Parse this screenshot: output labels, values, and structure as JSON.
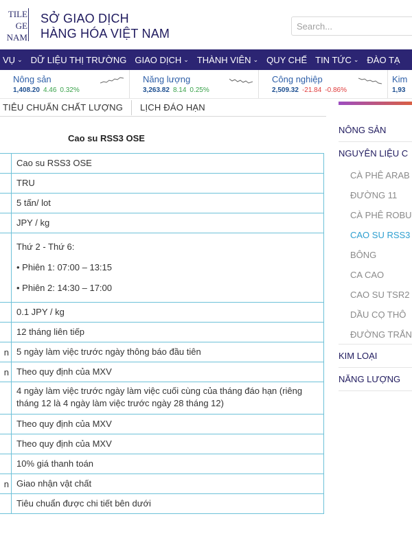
{
  "header": {
    "logo_lines": [
      "TILE",
      "GE",
      "NAM"
    ],
    "org_name_line1": "SỞ GIAO DỊCH",
    "org_name_line2": "HÀNG HÓA VIỆT NAM",
    "search_placeholder": "Search..."
  },
  "nav": {
    "items": [
      "VỤ",
      "DỮ LIỆU THỊ TRƯỜNG",
      "GIAO DỊCH",
      "THÀNH VIÊN",
      "QUY CHẾ",
      "TIN TỨC",
      "ĐÀO TẠ"
    ]
  },
  "ticker": {
    "items": [
      {
        "name": "Nông sản",
        "price": "1,408.20",
        "change": "4.46",
        "pct": "0.32%",
        "dir": "up"
      },
      {
        "name": "Năng lượng",
        "price": "3,263.82",
        "change": "8.14",
        "pct": "0.25%",
        "dir": "up"
      },
      {
        "name": "Công nghiệp",
        "price": "2,509.32",
        "change": "-21.84",
        "pct": "-0.86%",
        "dir": "down"
      },
      {
        "name": "Kim",
        "price": "1,93"
      }
    ]
  },
  "tabs": [
    "TIÊU CHUẨN CHẤT LƯỢNG",
    "LỊCH ĐÁO HẠN"
  ],
  "table": {
    "title": "Cao su RSS3 OSE",
    "rows": [
      {
        "label": "",
        "lines": [
          "Cao su RSS3 OSE"
        ]
      },
      {
        "label": "",
        "lines": [
          "TRU"
        ]
      },
      {
        "label": "",
        "lines": [
          "5 tấn/ lot"
        ]
      },
      {
        "label": "",
        "lines": [
          "JPY / kg"
        ]
      },
      {
        "label": "",
        "lines": [
          "Thứ 2 - Thứ 6:",
          "• Phiên 1: 07:00 – 13:15",
          "• Phiên 2: 14:30 – 17:00"
        ]
      },
      {
        "label": "",
        "lines": [
          "0.1 JPY / kg"
        ]
      },
      {
        "label": "",
        "lines": [
          "12 tháng liên tiếp"
        ]
      },
      {
        "label": "n",
        "lines": [
          "5 ngày làm việc trước ngày thông báo đầu tiên"
        ]
      },
      {
        "label": "n",
        "lines": [
          "Theo quy định của MXV"
        ]
      },
      {
        "label": "",
        "lines": [
          "4 ngày làm việc trước ngày làm việc cuối cùng của tháng đáo hạn (riêng tháng 12 là 4 ngày làm việc trước ngày 28 tháng 12)"
        ]
      },
      {
        "label": "",
        "lines": [
          "Theo quy định của MXV"
        ]
      },
      {
        "label": "",
        "lines": [
          "Theo quy định của MXV"
        ]
      },
      {
        "label": "",
        "lines": [
          "10% giá thanh toán"
        ]
      },
      {
        "label": "n",
        "lines": [
          "Giao nhận vật chất"
        ]
      },
      {
        "label": "",
        "lines": [
          "Tiêu chuẩn được chi tiết bên dưới"
        ]
      }
    ]
  },
  "sidebar": {
    "categories": [
      {
        "label": "NÔNG SẢN",
        "subs": []
      },
      {
        "label": "NGUYÊN LIỆU C",
        "subs": [
          {
            "label": "CÀ PHÊ ARAB",
            "active": false
          },
          {
            "label": "ĐƯỜNG 11",
            "active": false
          },
          {
            "label": "CÀ PHÊ ROBU",
            "active": false
          },
          {
            "label": "CAO SU RSS3",
            "active": true
          },
          {
            "label": "BÔNG",
            "active": false
          },
          {
            "label": "CA CAO",
            "active": false
          },
          {
            "label": "CAO SU TSR2",
            "active": false
          },
          {
            "label": "DẦU CỌ THÔ",
            "active": false
          },
          {
            "label": "ĐƯỜNG TRẮN",
            "active": false
          }
        ]
      },
      {
        "label": "KIM LOẠI",
        "subs": []
      },
      {
        "label": "NĂNG LƯỢNG",
        "subs": []
      }
    ]
  },
  "colors": {
    "brand": "#2c2573",
    "link": "#2e5fa8",
    "up": "#3aa24b",
    "down": "#e03b3b",
    "table_border": "#6cc1d8",
    "active_sub": "#2d9fd0"
  }
}
